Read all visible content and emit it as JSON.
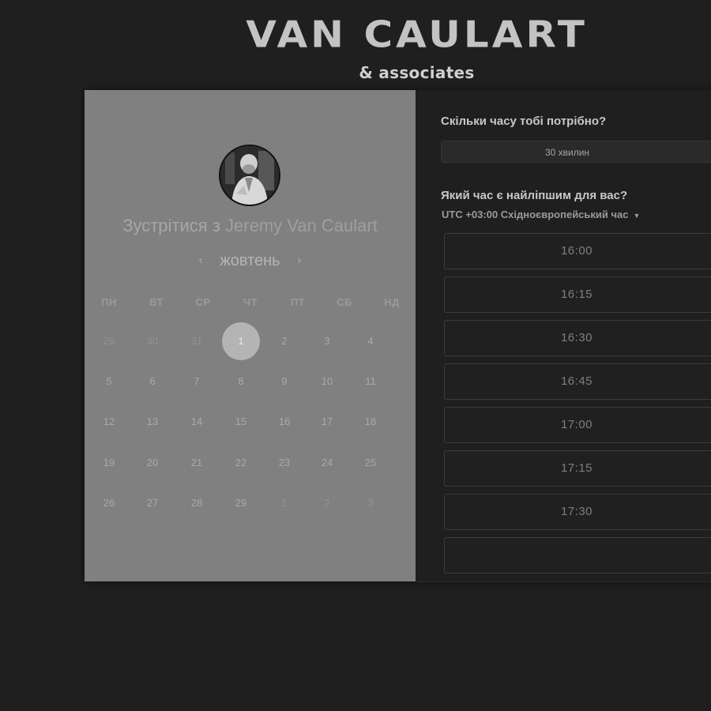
{
  "brand": {
    "name": "VAN CAULART",
    "tagline": "& associates"
  },
  "left": {
    "title_prefix": "Зустрітися з",
    "host_name": "Jeremy Van Caulart",
    "month": "жовтень",
    "prev_icon": "chevron-left-icon",
    "next_icon": "chevron-right-icon",
    "weekdays": [
      "ПН",
      "ВТ",
      "СР",
      "ЧТ",
      "ПТ",
      "СБ",
      "НД"
    ],
    "weeks": [
      [
        "29",
        "30",
        "31",
        "1",
        "2",
        "3",
        "4"
      ],
      [
        "5",
        "6",
        "7",
        "8",
        "9",
        "10",
        "11"
      ],
      [
        "12",
        "13",
        "14",
        "15",
        "16",
        "17",
        "18"
      ],
      [
        "19",
        "20",
        "21",
        "22",
        "23",
        "24",
        "25"
      ],
      [
        "26",
        "27",
        "28",
        "29",
        "1",
        "2",
        "3"
      ]
    ],
    "selected_day": "1"
  },
  "right": {
    "duration_question": "Скільки часу тобі потрібно?",
    "duration_value": "30 хвилин",
    "time_question": "Який час є найліпшим для вас?",
    "timezone": "UTC +03:00 Східноєвропейський час",
    "slots": [
      "16:00",
      "16:15",
      "16:30",
      "16:45",
      "17:00",
      "17:15",
      "17:30"
    ]
  }
}
